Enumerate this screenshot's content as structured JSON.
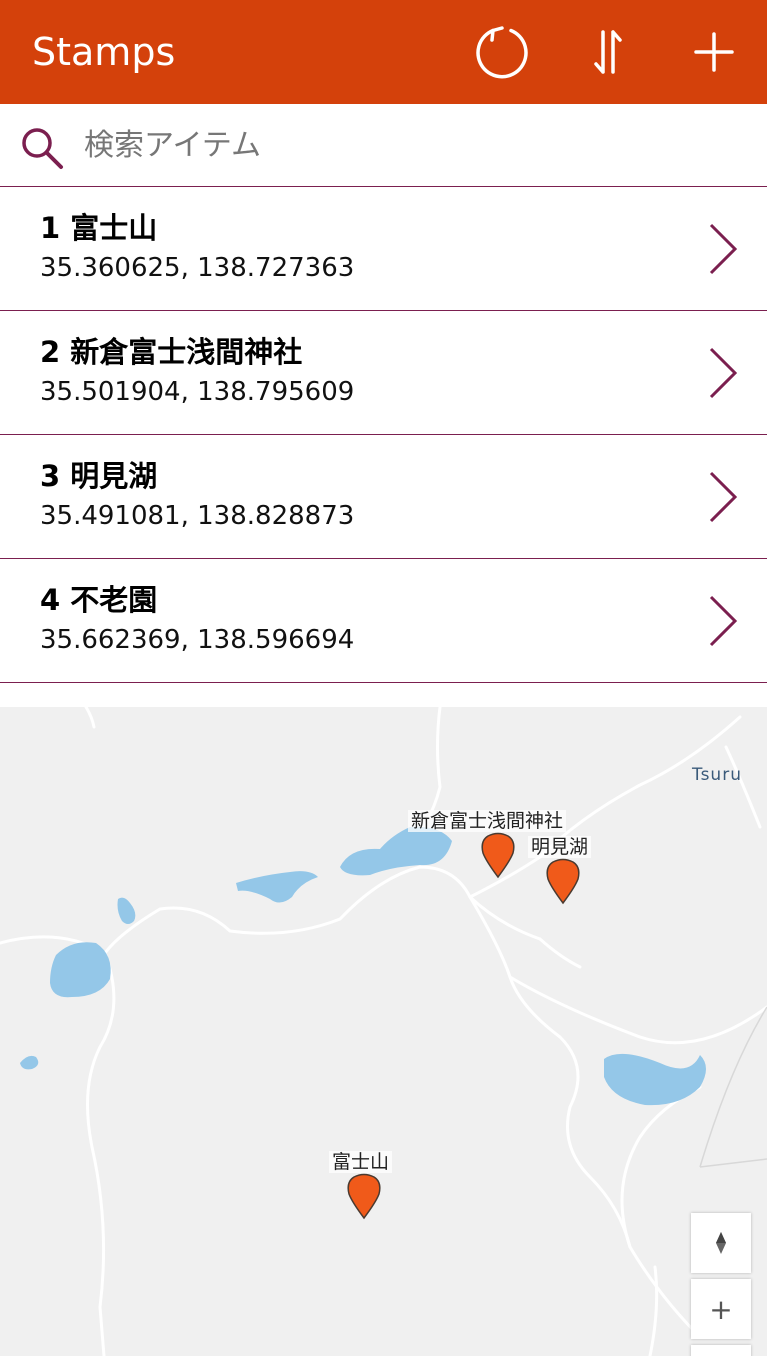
{
  "header": {
    "title": "Stamps",
    "icons": [
      "refresh-icon",
      "sort-icon",
      "add-icon"
    ]
  },
  "search": {
    "placeholder": "検索アイテム",
    "value": ""
  },
  "list": {
    "items": [
      {
        "title": "1 富士山",
        "coords": "35.360625, 138.727363"
      },
      {
        "title": "2 新倉富士浅間神社",
        "coords": "35.501904, 138.795609"
      },
      {
        "title": "3 明見湖",
        "coords": "35.491081, 138.828873"
      },
      {
        "title": "4 不老園",
        "coords": "35.662369, 138.596694"
      }
    ]
  },
  "map": {
    "markers": [
      {
        "label": "新倉富士浅間神社"
      },
      {
        "label": "明見湖"
      },
      {
        "label": "富士山"
      }
    ],
    "city_label": "Tsuru",
    "controls": {
      "zoom_in": "+"
    }
  },
  "colors": {
    "header_bg": "#d4410b",
    "accent": "#7b1f4f",
    "marker": "#f05a1a",
    "water": "#94c7e8",
    "map_bg": "#f0f0f0"
  }
}
